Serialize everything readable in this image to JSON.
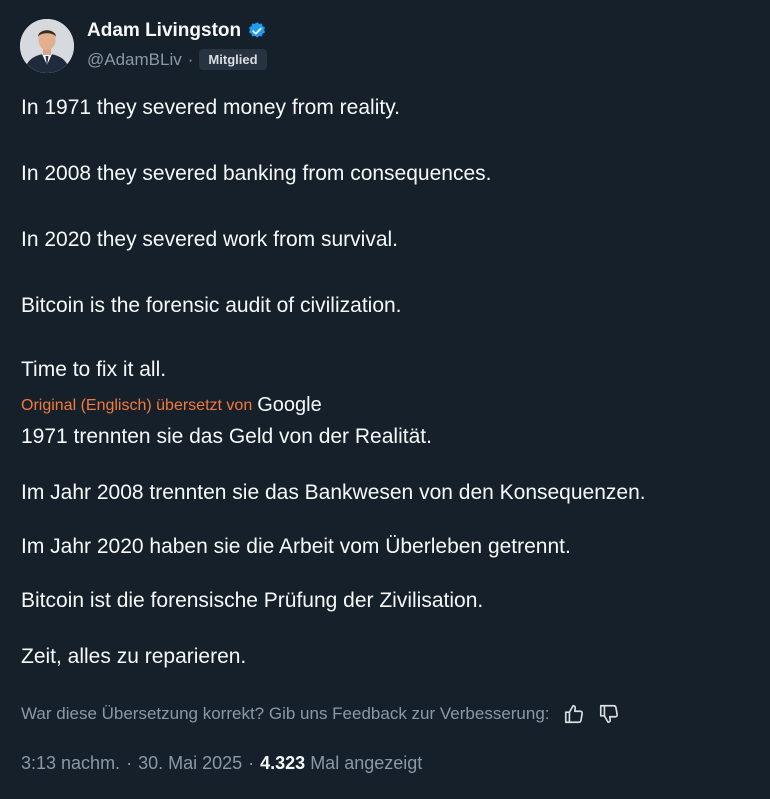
{
  "author": {
    "name": "Adam Livingston",
    "handle": "@AdamBLiv",
    "badge": "Mitglied",
    "verified_color": "#1d9bf0"
  },
  "original_lines": [
    "In 1971 they severed money from reality.",
    "In 2008 they severed banking from consequences.",
    "In 2020 they severed work from survival.",
    "Bitcoin is the forensic audit of civilization.",
    "Time to fix it all."
  ],
  "translation": {
    "label": "Original (Englisch) übersetzt von",
    "provider": "Google",
    "label_color": "#f4793a",
    "lines": [
      "1971 trennten sie das Geld von der Realität.",
      "Im Jahr 2008 trennten sie das Bankwesen von den Konsequenzen.",
      "Im Jahr 2020 haben sie die Arbeit vom Überleben getrennt.",
      "Bitcoin ist die forensische Prüfung der Zivilisation.",
      "Zeit, alles zu reparieren."
    ]
  },
  "feedback": {
    "text": "War diese Übersetzung korrekt? Gib uns Feedback zur Verbesserung:",
    "thumbs_up_icon": "thumbs-up-icon",
    "thumbs_down_icon": "thumbs-down-icon"
  },
  "meta": {
    "time": "3:13 nachm.",
    "date": "30. Mai 2025",
    "views_count": "4.323",
    "views_label": "Mal angezeigt"
  }
}
